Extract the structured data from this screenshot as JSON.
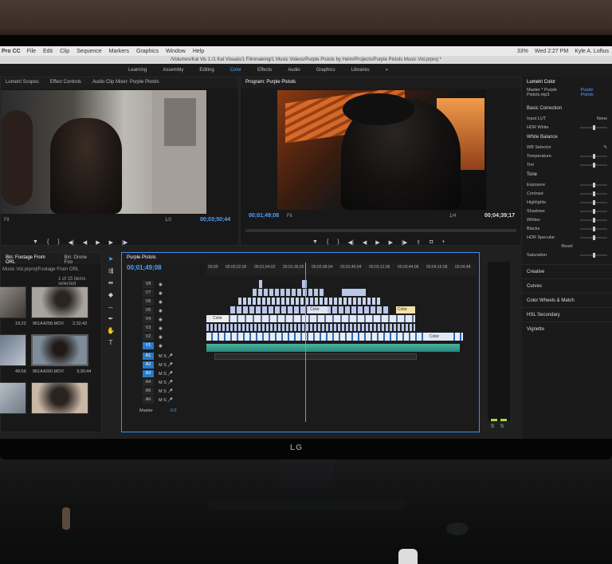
{
  "scene": {
    "monitor_brand": "LG"
  },
  "menubar": {
    "app": "Pro CC",
    "items": [
      "File",
      "Edit",
      "Clip",
      "Sequence",
      "Markers",
      "Graphics",
      "Window",
      "Help"
    ],
    "battery": "33%",
    "clock": "Wed 2:27 PM",
    "user": "Kyle A. Loftus"
  },
  "pathbar": "/Volumes/Kal Vis 1./1 Kal Visuals/1 Filmmaking/1 Music Videos/Purple Pistols by Helm/Projects/Purple Pistols Music Vid.prproj *",
  "workspaces": [
    "Learning",
    "Assembly",
    "Editing",
    "Color",
    "Effects",
    "Audio",
    "Graphics",
    "Libraries",
    "»"
  ],
  "workspace_active": "Color",
  "source_panel": {
    "tabs": [
      "Lumetri Scopes",
      "Effect Controls",
      "Audio Clip Mixer: Purple Pistols"
    ],
    "fit": "Fit",
    "ratio": "1/2",
    "timecode": "00;03;50;44"
  },
  "program_panel": {
    "title": "Program: Purple Pistols",
    "timecode": "00;01;49;08",
    "fit": "Fit",
    "ratio": "1/4",
    "duration": "00;04;39;17"
  },
  "project_panel": {
    "tabs": [
      "Bin: Footage From ORL",
      "Bin: Drone Foo"
    ],
    "path": "Music Vid.prproj\\Footage From ORL",
    "count": "1 of 15 items selected",
    "clips": [
      {
        "duration": "19;22",
        "name": ""
      },
      {
        "duration": "2;32;42",
        "name": "961A4258.MOV"
      },
      {
        "duration": "49;56",
        "name": ""
      },
      {
        "duration": "3;30;44",
        "name": "961A4260.MOV"
      }
    ]
  },
  "timeline": {
    "title": "Purple Pistols",
    "timecode": "00;01;49;08",
    "ruler": [
      "00;00",
      "00;00;32;00",
      "00;01;04;02",
      "00;01;36;02",
      "00;02;08;04",
      "00;02;40;04",
      "00;03;12;06",
      "00;03;44;06",
      "00;04;16;08",
      "00;04;48"
    ],
    "video_tracks": [
      "V8",
      "V7",
      "V6",
      "V5",
      "V4",
      "V3",
      "V2",
      "V1"
    ],
    "audio_tracks": [
      "A1",
      "A2",
      "A3",
      "A4",
      "A5",
      "A6"
    ],
    "master_label": "Master",
    "master_value": "0.0",
    "clip_labels": [
      "Color",
      "Color",
      "Color",
      "Color"
    ]
  },
  "meter": {
    "labels": [
      "S",
      "S"
    ],
    "level": 0.02
  },
  "lumetri": {
    "title": "Lumetri Color",
    "source": "Master * Purple Pistols.mp3",
    "target": "Purple Pistols",
    "basic": "Basic Correction",
    "input_lut_label": "Input LUT",
    "input_lut_value": "None",
    "hdr_white": "HDR White",
    "white_balance": "White Balance",
    "wb_rows": [
      "WB Selector",
      "Temperature",
      "Tint"
    ],
    "tone": "Tone",
    "tone_rows": [
      "Exposure",
      "Contrast",
      "Highlights",
      "Shadows",
      "Whites",
      "Blacks",
      "HDR Specular"
    ],
    "reset": "Reset",
    "saturation": "Saturation",
    "sections": [
      "Creative",
      "Curves",
      "Color Wheels & Match",
      "HSL Secondary",
      "Vignette"
    ]
  }
}
